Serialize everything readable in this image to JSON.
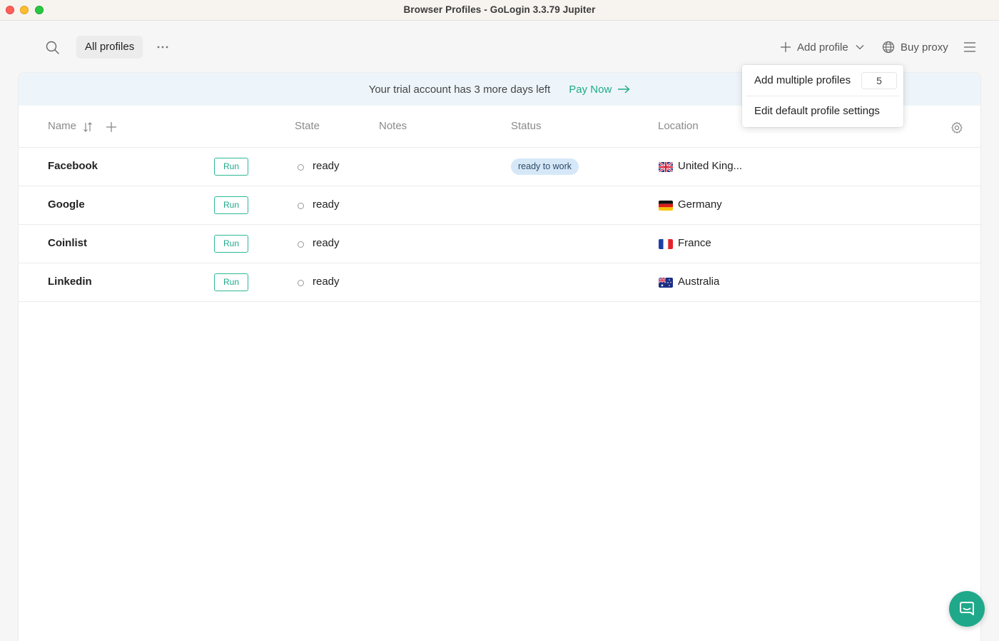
{
  "window": {
    "title": "Browser Profiles - GoLogin 3.3.79 Jupiter"
  },
  "toolbar": {
    "all_profiles_label": "All profiles",
    "add_profile_label": "Add profile",
    "buy_proxy_label": "Buy proxy"
  },
  "banner": {
    "message": "Your trial account has 3 more days left",
    "pay_now_label": "Pay Now"
  },
  "table": {
    "columns": {
      "name": "Name",
      "state": "State",
      "notes": "Notes",
      "status": "Status",
      "location": "Location"
    },
    "rows": [
      {
        "name": "Facebook",
        "run_label": "Run",
        "state": "ready",
        "notes": "",
        "status": "ready to work",
        "location": "United King...",
        "flag": "uk-flag"
      },
      {
        "name": "Google",
        "run_label": "Run",
        "state": "ready",
        "notes": "",
        "status": "",
        "location": "Germany",
        "flag": "de-flag"
      },
      {
        "name": "Coinlist",
        "run_label": "Run",
        "state": "ready",
        "notes": "",
        "status": "",
        "location": "France",
        "flag": "fr-flag"
      },
      {
        "name": "Linkedin",
        "run_label": "Run",
        "state": "ready",
        "notes": "",
        "status": "",
        "location": "Australia",
        "flag": "au-flag"
      }
    ]
  },
  "dropdown": {
    "add_multiple_label": "Add multiple profiles",
    "add_multiple_count": "5",
    "edit_default_label": "Edit default profile settings"
  },
  "colors": {
    "accent": "#1fa98a",
    "banner_bg": "#eef5fa",
    "status_pill_bg": "#d6e8f8"
  }
}
